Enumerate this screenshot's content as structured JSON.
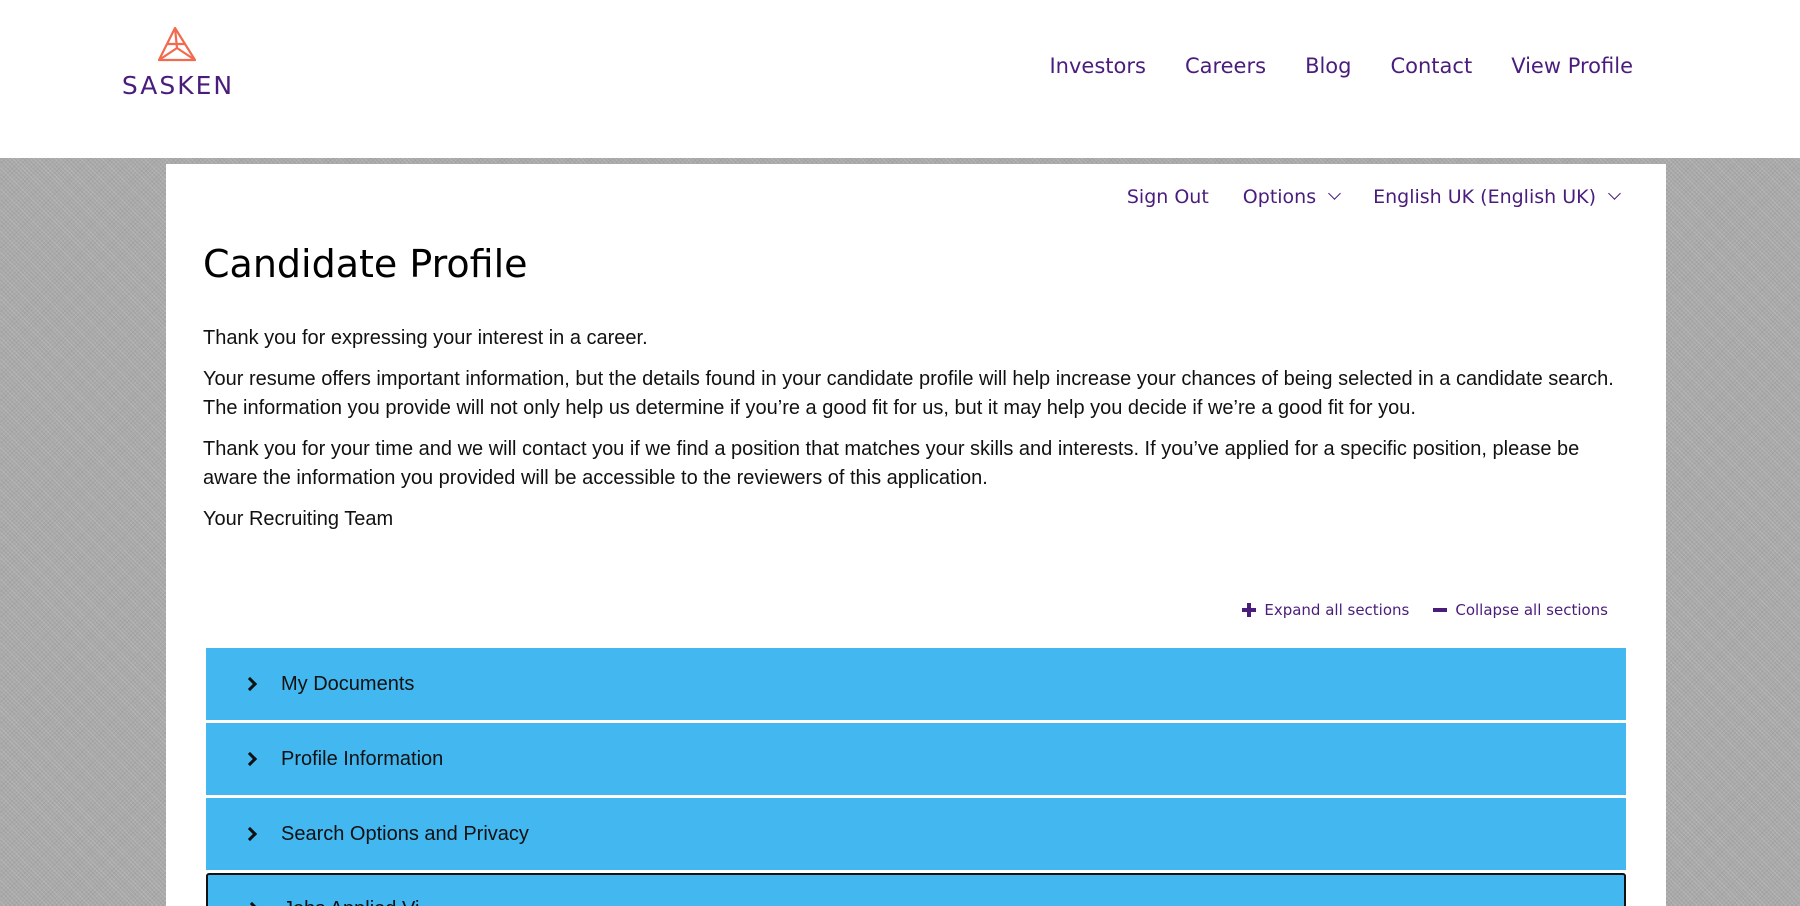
{
  "brand": {
    "name": "SASKEN",
    "accent": "#4a1d7d",
    "logo_mark_color": "#f26a4f"
  },
  "nav": {
    "items": [
      {
        "label": "Investors"
      },
      {
        "label": "Careers"
      },
      {
        "label": "Blog"
      },
      {
        "label": "Contact"
      },
      {
        "label": "View Profile"
      }
    ]
  },
  "utility": {
    "sign_out": "Sign Out",
    "options": "Options",
    "language": "English UK (English UK)"
  },
  "page": {
    "title": "Candidate Profile",
    "paragraphs": [
      "Thank you for expressing your interest in a career.",
      "Your resume offers important information, but the details found in your candidate profile will help increase your chances of being selected in a candidate search. The information you provide will not only help us determine if you’re a good fit for us, but it may help you decide if we’re a good fit for you.",
      "Thank you for your time and we will contact you if we find a position that matches your skills and interests. If you’ve applied for a specific position, please be aware the information you provided will be accessible to the reviewers of this application.",
      "Your Recruiting Team"
    ]
  },
  "sections": {
    "expand_all": "Expand all sections",
    "collapse_all": "Collapse all sections",
    "items": [
      {
        "label": "My Documents"
      },
      {
        "label": "Profile Information"
      },
      {
        "label": "Search Options and Privacy"
      },
      {
        "label": "Jobs Applied Vi"
      }
    ],
    "bar_color": "#42b7f0"
  }
}
